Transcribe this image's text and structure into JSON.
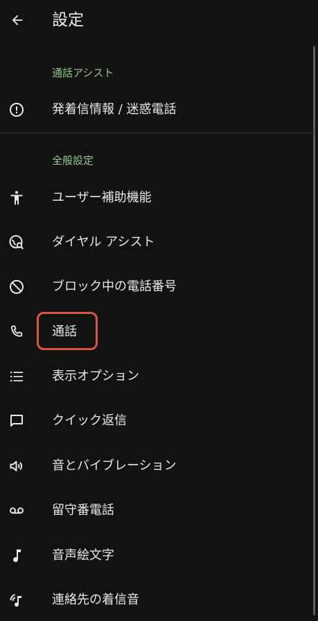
{
  "header": {
    "title": "設定",
    "back_icon": "arrow-left-icon"
  },
  "sections": [
    {
      "header": "通話アシスト",
      "items": [
        {
          "icon": "alert-circle-icon",
          "label": "発着信情報 / 迷惑電話"
        }
      ]
    },
    {
      "header": "全般設定",
      "items": [
        {
          "icon": "accessibility-icon",
          "label": "ユーザー補助機能"
        },
        {
          "icon": "dialing-assist-icon",
          "label": "ダイヤル アシスト"
        },
        {
          "icon": "block-icon",
          "label": "ブロック中の電話番号"
        },
        {
          "icon": "phone-icon",
          "label": "通話"
        },
        {
          "icon": "list-icon",
          "label": "表示オプション"
        },
        {
          "icon": "message-icon",
          "label": "クイック返信"
        },
        {
          "icon": "volume-icon",
          "label": "音とバイブレーション"
        },
        {
          "icon": "voicemail-icon",
          "label": "留守番電話"
        },
        {
          "icon": "music-note-icon",
          "label": "音声絵文字"
        },
        {
          "icon": "contact-ringtone-icon",
          "label": "連絡先の着信音"
        }
      ]
    }
  ],
  "colors": {
    "background": "#121212",
    "section_header": "#8ecb8e",
    "highlight_border": "#e0533d"
  }
}
